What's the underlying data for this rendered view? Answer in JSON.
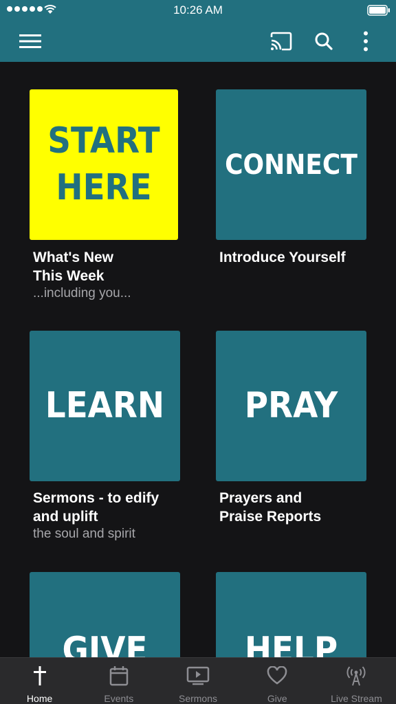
{
  "status_bar": {
    "time": "10:26 AM"
  },
  "header": {
    "icons": [
      "menu-icon",
      "cast-icon",
      "search-icon",
      "more-vertical-icon"
    ]
  },
  "tiles": [
    {
      "line1": "START",
      "line2": "HERE",
      "caption1": "What's New",
      "caption2": "This Week",
      "subtitle": "...including you..."
    },
    {
      "line1": "CONNECT",
      "caption1": "Introduce Yourself"
    },
    {
      "line1": "LEARN",
      "caption1": "Sermons - to edify",
      "caption2": "and uplift",
      "subtitle": "the soul and spirit"
    },
    {
      "line1": "PRAY",
      "caption1": "Prayers and",
      "caption2": "Praise Reports"
    },
    {
      "line1": "GIVE"
    },
    {
      "line1": "HELP"
    }
  ],
  "bottom_nav": {
    "items": [
      {
        "label": "Home",
        "icon": "cross-icon",
        "active": true
      },
      {
        "label": "Events",
        "icon": "calendar-icon",
        "active": false
      },
      {
        "label": "Sermons",
        "icon": "play-screen-icon",
        "active": false
      },
      {
        "label": "Give",
        "icon": "heart-icon",
        "active": false
      },
      {
        "label": "Live Stream",
        "icon": "broadcast-icon",
        "active": false
      }
    ]
  },
  "colors": {
    "brand": "#22707f",
    "highlight": "#ffff00",
    "background": "#141416",
    "nav_background": "#2a2a2c",
    "nav_inactive": "#8e8e93"
  }
}
